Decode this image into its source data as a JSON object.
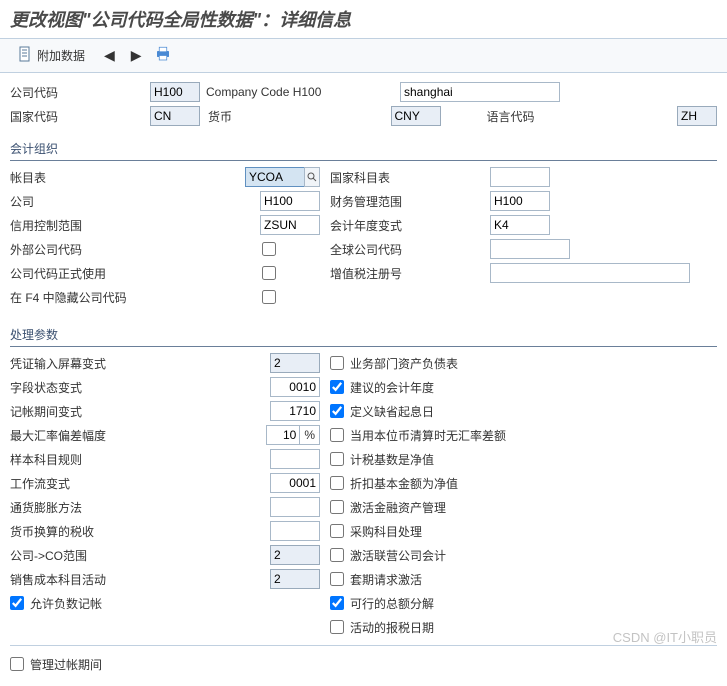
{
  "title": "更改视图\"公司代码全局性数据\"：详细信息",
  "toolbar": {
    "additional_data": "附加数据"
  },
  "header": {
    "company_code_lbl": "公司代码",
    "company_code": "H100",
    "company_code_desc": "Company Code H100",
    "city": "shanghai",
    "country_lbl": "国家代码",
    "country": "CN",
    "currency_lbl": "货币",
    "currency": "CNY",
    "language_lbl": "语言代码",
    "language": "ZH"
  },
  "section1": {
    "title": "会计组织",
    "chart_accounts_lbl": "帐目表",
    "chart_accounts": "YCOA",
    "country_coa_lbl": "国家科目表",
    "country_coa": "",
    "company_lbl": "公司",
    "company": "H100",
    "fm_area_lbl": "财务管理范围",
    "fm_area": "H100",
    "credit_ctrl_lbl": "信用控制范围",
    "credit_ctrl": "ZSUN",
    "fy_variant_lbl": "会计年度变式",
    "fy_variant": "K4",
    "ext_cocode_lbl": "外部公司代码",
    "global_cocode_lbl": "全球公司代码",
    "global_cocode": "",
    "cocode_prod_lbl": "公司代码正式使用",
    "vat_reg_lbl": "增值税注册号",
    "vat_reg": "",
    "hide_f4_lbl": "在 F4 中隐藏公司代码"
  },
  "section2": {
    "title": "处理参数",
    "doc_entry_var_lbl": "凭证输入屏幕变式",
    "doc_entry_var": "2",
    "field_status_lbl": "字段状态变式",
    "field_status": "0010",
    "posting_period_lbl": "记帐期间变式",
    "posting_period": "1710",
    "max_exch_dev_lbl": "最大汇率偏差幅度",
    "max_exch_dev": "10",
    "max_exch_unit": "%",
    "sample_rule_lbl": "样本科目规则",
    "sample_rule": "",
    "workflow_var_lbl": "工作流变式",
    "workflow_var": "0001",
    "inflation_lbl": "通货膨胀方法",
    "inflation": "",
    "tax_crcy_lbl": "货币换算的税收",
    "tax_crcy": "",
    "co_area_lbl": "公司->CO范围",
    "co_area": "2",
    "cogs_lbl": "销售成本科目活动",
    "cogs": "2",
    "neg_posting_lbl": "允许负数记帐",
    "cb_bus_area_bs": "业务部门资产负债表",
    "cb_propose_fy": "建议的会计年度",
    "cb_default_valdate": "定义缺省起息日",
    "cb_no_exch_diff": "当用本位币清算时无汇率差额",
    "cb_net_tax_base": "计税基数是净值",
    "cb_disc_base_net": "折扣基本金额为净值",
    "cb_fin_asset": "激活金融资产管理",
    "cb_purch_proc": "采购科目处理",
    "cb_jva": "激活联营公司会计",
    "cb_hedge_req": "套期请求激活",
    "cb_amount_split": "可行的总额分解",
    "cb_active_tax_date": "活动的报税日期",
    "manage_period_lbl": "管理过帐期间"
  },
  "watermark": "CSDN @IT小职员"
}
